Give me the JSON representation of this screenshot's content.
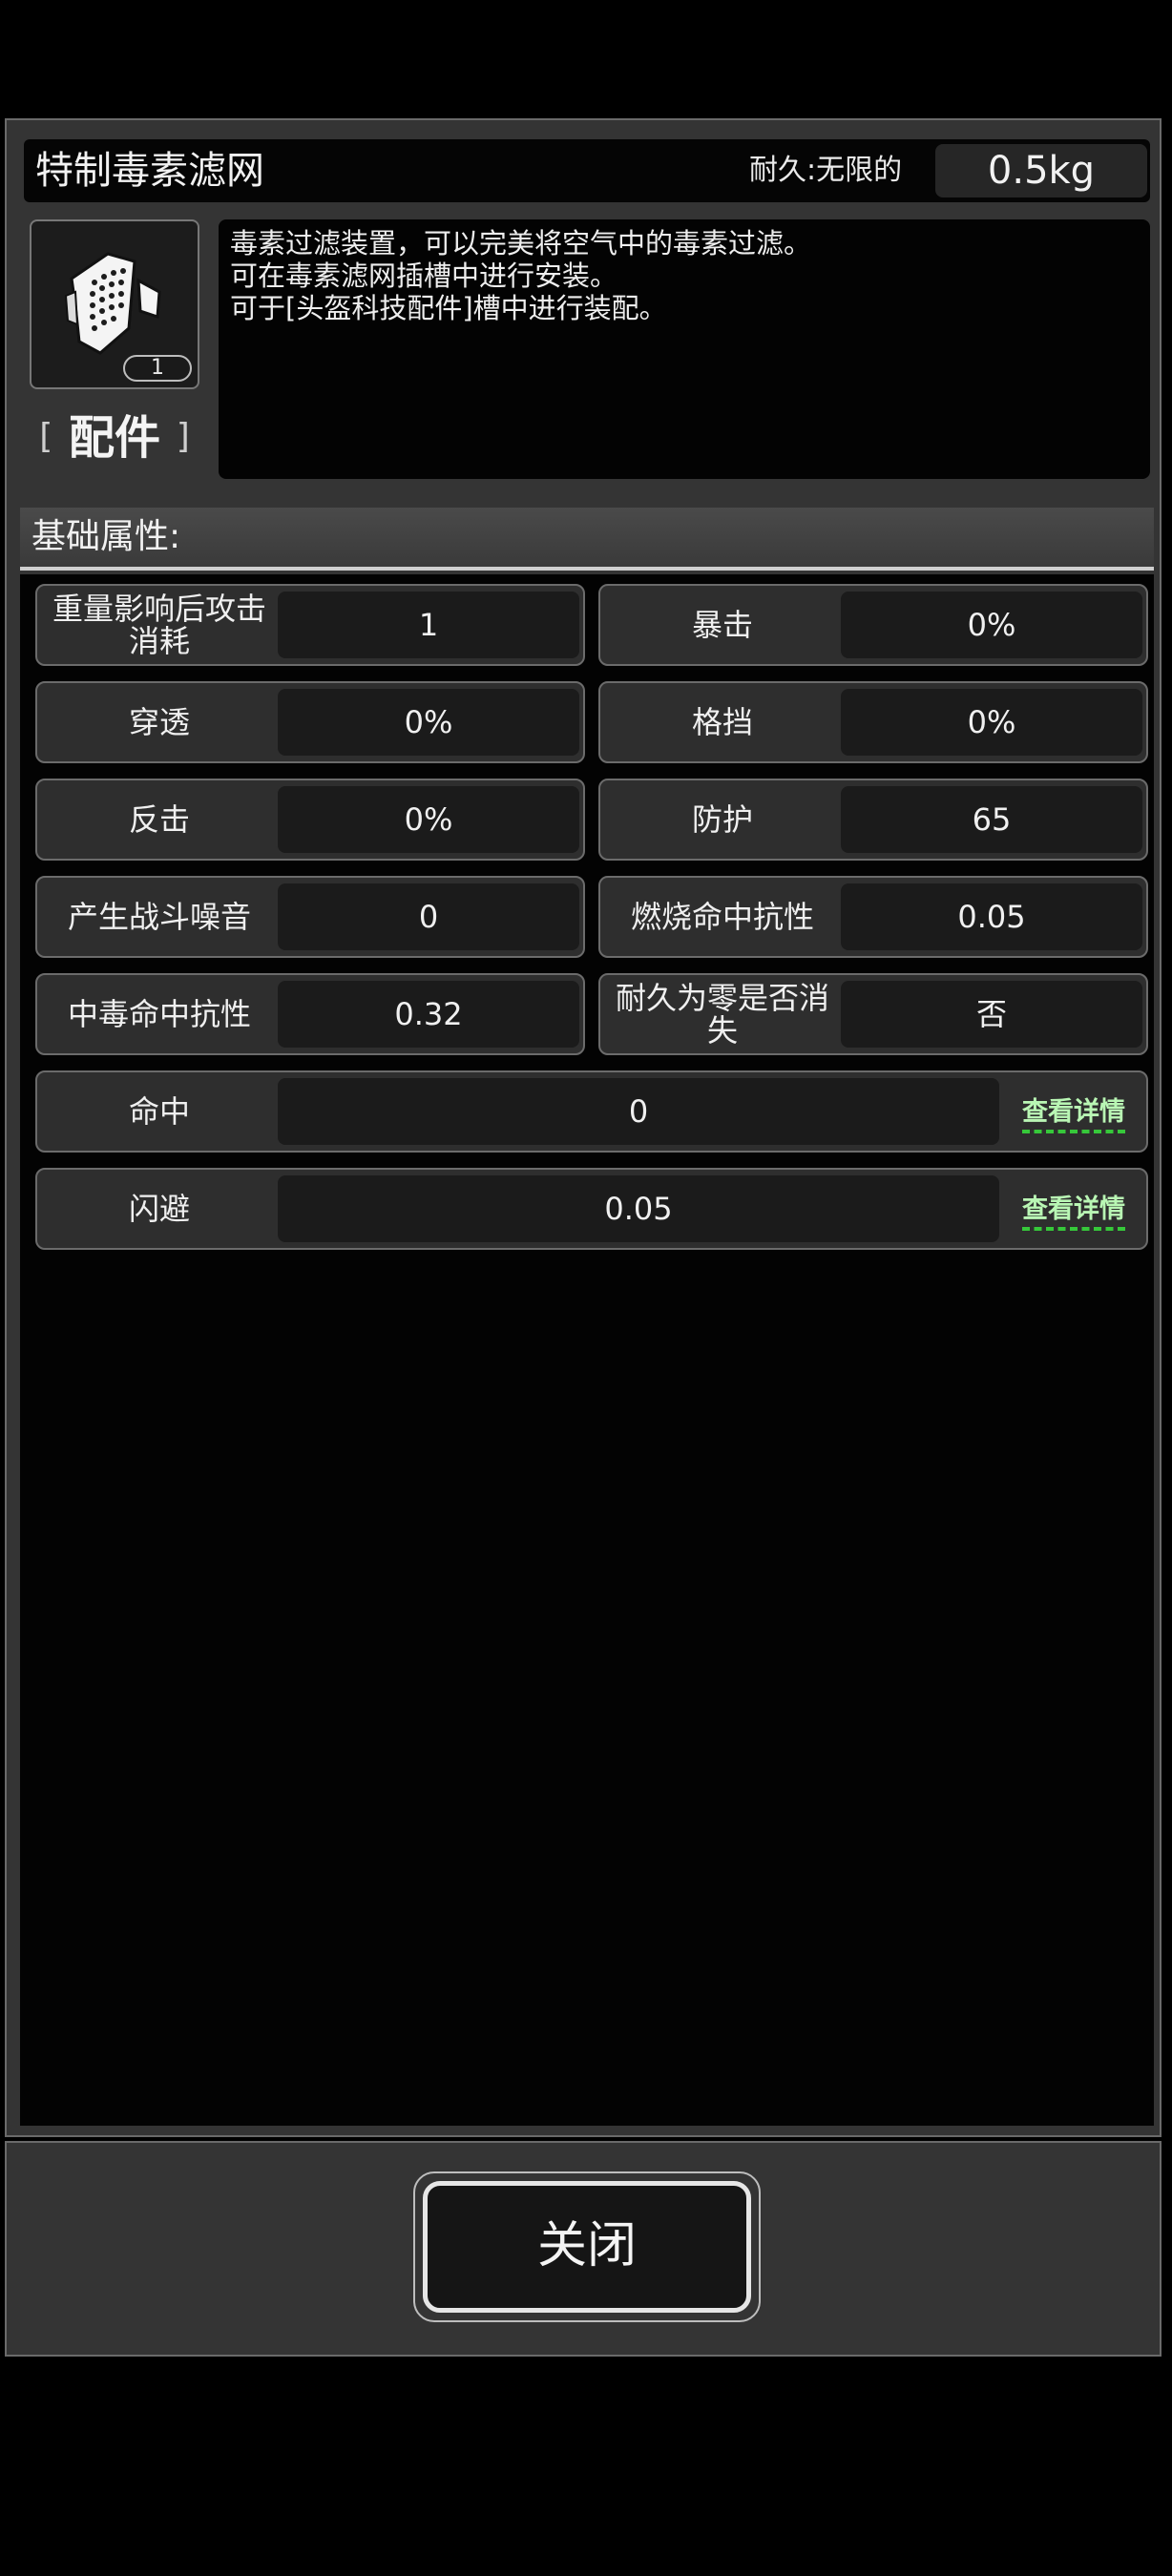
{
  "item": {
    "name": "特制毒素滤网",
    "durability": "耐久:无限的",
    "weight": "0.5kg",
    "count": "1",
    "category": "配件",
    "category_open": "[",
    "category_close": "]",
    "icon": "filter-mask-icon",
    "description": [
      "毒素过滤装置，可以完美将空气中的毒素过滤。",
      "可在毒素滤网插槽中进行安装。",
      "可于[头盔科技配件]槽中进行装配。"
    ]
  },
  "section": {
    "title": "基础属性:"
  },
  "attributes": [
    {
      "label": "重量影响后攻击消耗",
      "value": "1"
    },
    {
      "label": "暴击",
      "value": "0%"
    },
    {
      "label": "穿透",
      "value": "0%"
    },
    {
      "label": "格挡",
      "value": "0%"
    },
    {
      "label": "反击",
      "value": "0%"
    },
    {
      "label": "防护",
      "value": "65"
    },
    {
      "label": "产生战斗噪音",
      "value": "0"
    },
    {
      "label": "燃烧命中抗性",
      "value": "0.05"
    },
    {
      "label": "中毒命中抗性",
      "value": "0.32"
    },
    {
      "label": "耐久为零是否消失",
      "value": "否"
    }
  ],
  "wide_attributes": [
    {
      "label": "命中",
      "value": "0",
      "link": "查看详情"
    },
    {
      "label": "闪避",
      "value": "0.05",
      "link": "查看详情"
    }
  ],
  "footer": {
    "close_label": "关闭"
  },
  "colors": {
    "panel": "#343434",
    "link": "#b9f6b4",
    "link_underline": "#36c83a"
  }
}
